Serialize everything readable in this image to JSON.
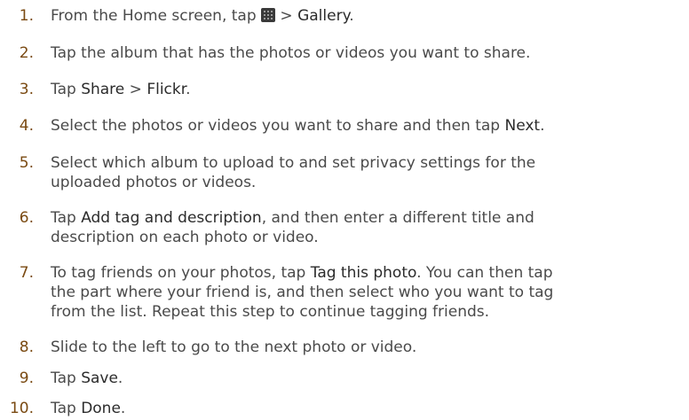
{
  "steps": [
    {
      "number": "1.",
      "parts": [
        "From the Home screen, tap ",
        " > ",
        "Gallery",
        "."
      ],
      "icon": "apps-grid-icon"
    },
    {
      "number": "2.",
      "text": "Tap the album that has the photos or videos you want to share."
    },
    {
      "number": "3.",
      "parts": [
        "Tap ",
        "Share",
        " > ",
        "Flickr",
        "."
      ]
    },
    {
      "number": "4.",
      "parts": [
        "Select the photos or videos you want to share and then tap ",
        "Next",
        "."
      ]
    },
    {
      "number": "5.",
      "lines": [
        "Select which album to upload to and set privacy settings for the",
        "uploaded photos or videos."
      ]
    },
    {
      "number": "6.",
      "parts": [
        "Tap ",
        "Add tag and description",
        ", and then enter a different title and"
      ],
      "line2": "description on each photo or video."
    },
    {
      "number": "7.",
      "parts": [
        "To tag friends on your photos, tap ",
        "Tag this photo",
        ". You can then tap"
      ],
      "line2": "the part where your friend is, and then select who you want to tag",
      "line3": "from the list. Repeat this step to continue tagging friends."
    },
    {
      "number": "8.",
      "text": "Slide to the left to go to the next photo or video."
    },
    {
      "number": "9.",
      "parts": [
        "Tap ",
        "Save",
        "."
      ]
    },
    {
      "number": "10.",
      "parts": [
        "Tap ",
        "Done",
        "."
      ]
    }
  ],
  "colors": {
    "number": "#7a4a12",
    "text": "#4a4a4a",
    "highlight": "#2b2b2b"
  }
}
